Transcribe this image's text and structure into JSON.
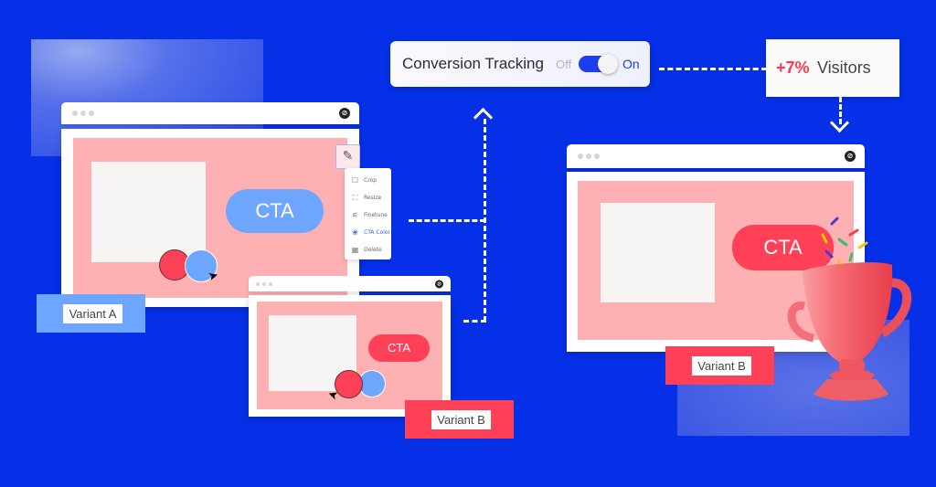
{
  "colors": {
    "background": "#0530e8",
    "variant_a": "#6ea6ff",
    "variant_b": "#ff4057",
    "pink_panel": "#ffb0b2",
    "accent_on": "#1b3ff0",
    "positive": "#ff3a55"
  },
  "tracking": {
    "label": "Conversion Tracking",
    "off_label": "Off",
    "on_label": "On",
    "toggle_state": "on"
  },
  "result": {
    "delta": "+7%",
    "metric": "Visitors"
  },
  "window_a": {
    "cta_label": "CTA",
    "variant_label": "Variant A",
    "logo_icon": "brand-logo-icon"
  },
  "edit_menu": {
    "edit_icon": "pencil-icon",
    "items": [
      {
        "label": "Crop",
        "icon": "crop-icon",
        "glyph": "☐"
      },
      {
        "label": "Resize",
        "icon": "resize-icon",
        "glyph": "⛶"
      },
      {
        "label": "Finetune",
        "icon": "sliders-icon",
        "glyph": "⚟"
      },
      {
        "label": "CTA Color",
        "icon": "color-palette-icon",
        "glyph": "❀",
        "active": true
      },
      {
        "label": "Delete",
        "icon": "trash-icon",
        "glyph": "🗑"
      }
    ]
  },
  "window_b_small": {
    "cta_label": "CTA",
    "variant_label": "Variant B"
  },
  "window_b_large": {
    "cta_label": "CTA",
    "variant_label": "Variant B"
  },
  "trophy": {
    "icon": "trophy-icon"
  }
}
